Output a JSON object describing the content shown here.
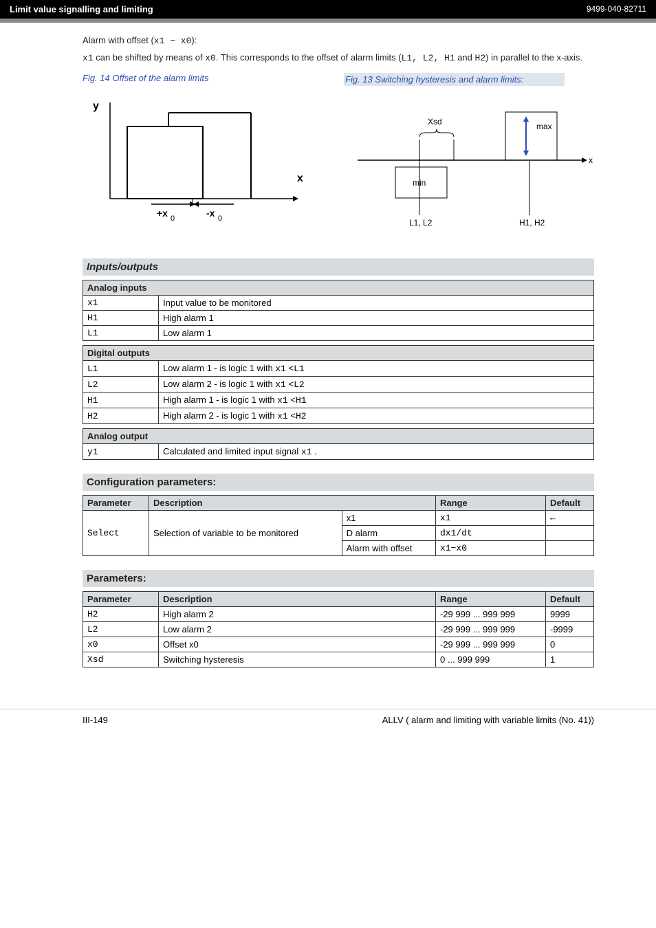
{
  "header": {
    "left": "Limit value signalling and limiting",
    "right": "9499-040-82711"
  },
  "intro": {
    "line1_a": "Alarm with offset (",
    "line1_b": "x1 − x0",
    "line1_c": "):",
    "line2_a": "x1",
    "line2_b": " can be shifted by means of ",
    "line2_c": "x0",
    "line2_d": ". This corresponds to the offset of alarm limits (",
    "line2_e": "L1, L2, H1",
    "line2_f": " and ",
    "line2_g": "H2",
    "line2_h": ") in parallel to the x-axis."
  },
  "fig14_caption": "Fig. 14  Offset of the alarm limits",
  "fig13_caption": "Fig. 13  Switching hysteresis and alarm limits:",
  "fig14_labels": {
    "y": "y",
    "x": "x",
    "plusx0": "+x",
    "sub0a": "0",
    "minusx0": "-x",
    "sub0b": "0"
  },
  "fig13_labels": {
    "xsd": "Xsd",
    "max": "max",
    "min": "min",
    "x": "x",
    "l1l2": "L1, L2",
    "h1h2": "H1, H2"
  },
  "inputs_outputs_title": "Inputs/outputs",
  "analog_inputs": {
    "title": "Analog inputs",
    "rows": [
      {
        "k": "x1",
        "v": "Input value to be monitored"
      },
      {
        "k": "H1",
        "v": "High alarm 1"
      },
      {
        "k": "L1",
        "v": "Low alarm 1"
      }
    ]
  },
  "digital_outputs": {
    "title": "Digital outputs",
    "rows": [
      {
        "k": "L1",
        "a": "Low alarm 1   - is logic 1 with ",
        "b": "x1",
        "c": " <",
        "d": "L1"
      },
      {
        "k": "L2",
        "a": "Low alarm 2   - is logic 1 with ",
        "b": "x1",
        "c": " <",
        "d": "L2"
      },
      {
        "k": "H1",
        "a": "High alarm 1  - is logic 1 with ",
        "b": "x1",
        "c": " <",
        "d": "H1"
      },
      {
        "k": "H2",
        "a": "High alarm 2  - is logic 1 with ",
        "b": "x1",
        "c": " <",
        "d": "H2"
      }
    ]
  },
  "analog_output": {
    "title": "Analog output",
    "k": "y1",
    "v_a": "Calculated and limited input signal ",
    "v_b": "x1",
    "v_c": " ."
  },
  "config_title": "Configuration parameters:",
  "config_header": {
    "p": "Parameter",
    "d": "Description",
    "r": "Range",
    "df": "Default"
  },
  "config": {
    "param": "Select",
    "desc": "Selection of variable to be monitored",
    "rows": [
      {
        "d": "x1",
        "r": "x1",
        "df": "←"
      },
      {
        "d": "D alarm",
        "r": "dx1/dt",
        "df": ""
      },
      {
        "d": "Alarm with offset",
        "r": "x1−x0",
        "df": ""
      }
    ]
  },
  "params_title": "Parameters:",
  "params_header": {
    "p": "Parameter",
    "d": "Description",
    "r": "Range",
    "df": "Default"
  },
  "params_rows": [
    {
      "p": "H2",
      "d": "High alarm 2",
      "r": "-29 999 ... 999 999",
      "df": "9999"
    },
    {
      "p": "L2",
      "d": "Low alarm 2",
      "r": "-29 999 ... 999 999",
      "df": "-9999"
    },
    {
      "p": "x0",
      "d": "Offset x0",
      "r": "-29 999 ... 999 999",
      "df": "0"
    },
    {
      "p": "Xsd",
      "d": "Switching hysteresis",
      "r": "0 ... 999 999",
      "df": "1"
    }
  ],
  "footer": {
    "left": "III-149",
    "right": "ALLV ( alarm and limiting with variable limits (No. 41))"
  }
}
